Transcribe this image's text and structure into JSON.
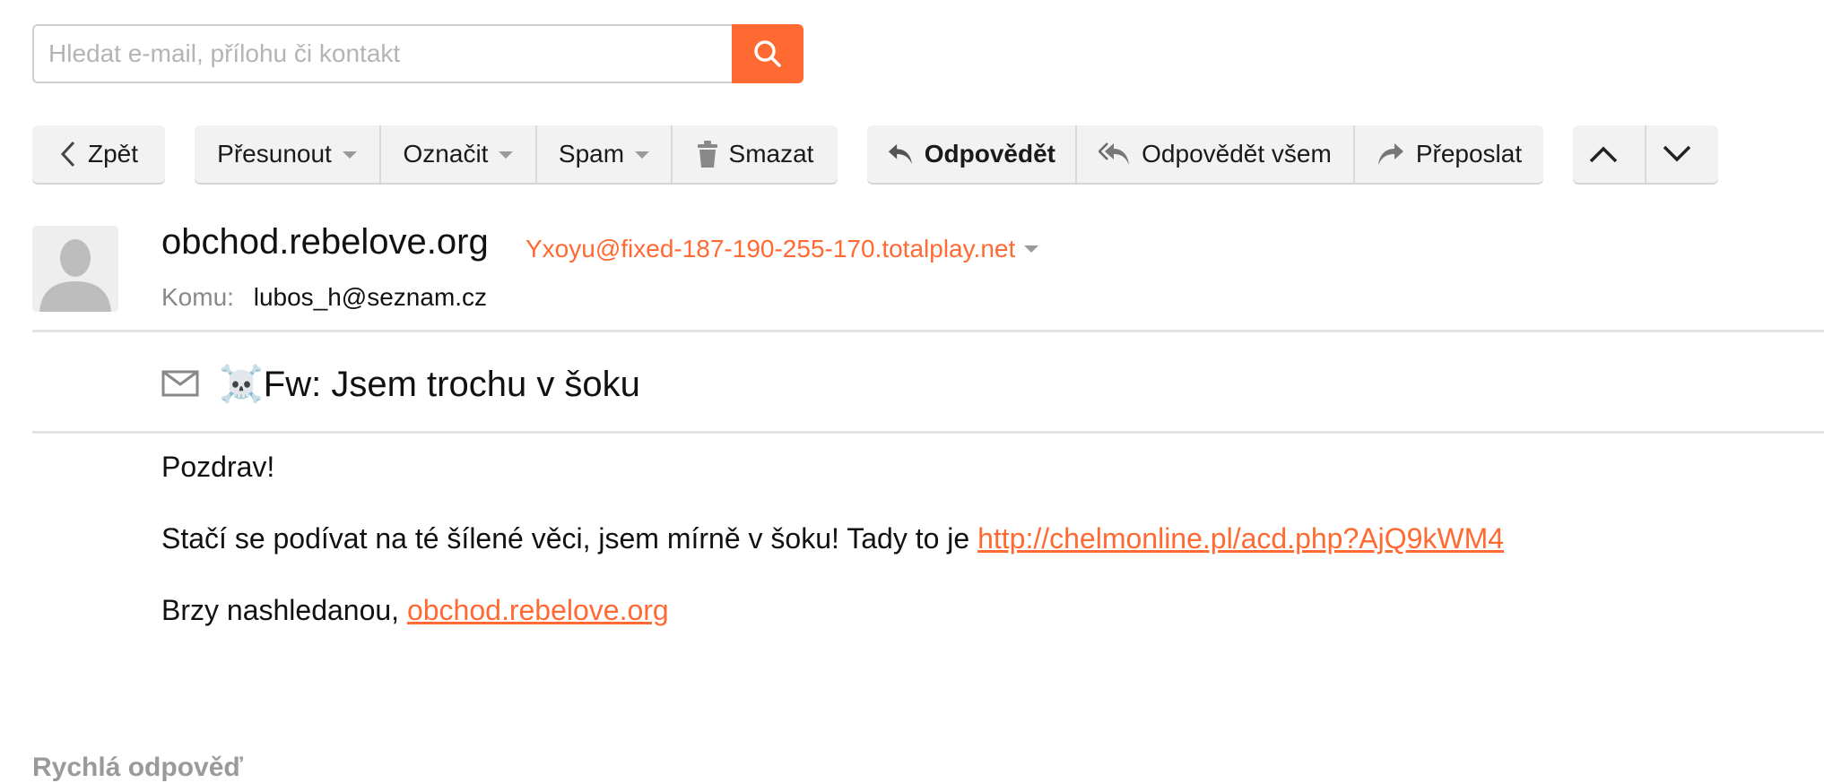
{
  "search": {
    "placeholder": "Hledat e-mail, přílohu či kontakt",
    "icon": "search-icon"
  },
  "toolbar": {
    "back_label": "Zpět",
    "move_label": "Přesunout",
    "mark_label": "Označit",
    "spam_label": "Spam",
    "delete_label": "Smazat",
    "reply_label": "Odpovědět",
    "reply_all_label": "Odpovědět všem",
    "forward_label": "Přeposlat"
  },
  "message": {
    "sender_name": "obchod.rebelove.org",
    "sender_email": "Yxoyu@fixed-187-190-255-170.totalplay.net",
    "to_label": "Komu:",
    "to_value": "lubos_h@seznam.cz",
    "subject": "☠️Fw: Jsem trochu v šoku",
    "body": {
      "greeting": "Pozdrav!",
      "line2_text": "Stačí se podívat na té šílené věci, jsem mírně v šoku! Tady to je ",
      "line2_link": "http://chelmonline.pl/acd.php?AjQ9kWM4",
      "line3_text": "Brzy nashledanou, ",
      "line3_link": "obchod.rebelove.org"
    }
  },
  "quick_reply_label": "Rychlá odpověď",
  "colors": {
    "accent": "#ff6a33",
    "button_bg": "#f2f2f2"
  }
}
